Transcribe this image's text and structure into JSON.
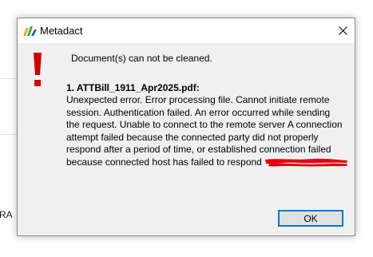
{
  "background": {
    "fragment_text": "RA"
  },
  "dialog": {
    "title": "Metadact",
    "close_icon": "close-icon",
    "alert_icon": "exclamation-icon",
    "alert_color": "#d20000",
    "headline": "Document(s) can not be cleaned.",
    "file_name": "1. ATTBill_1911_Apr2025.pdf:",
    "error_lines": [
      "Unexpected error. Error processing file. Cannot initiate remote",
      "session. Authentication failed. An error occurred while sending",
      "the request. Unable to connect to the remote server A connection",
      "attempt failed because the connected party did not properly",
      "respond after a period of time, or established connection failed",
      "because connected host has failed to respond"
    ],
    "redaction_color": "#e3000f",
    "ok_label": "OK",
    "accent": "#0078d7"
  }
}
